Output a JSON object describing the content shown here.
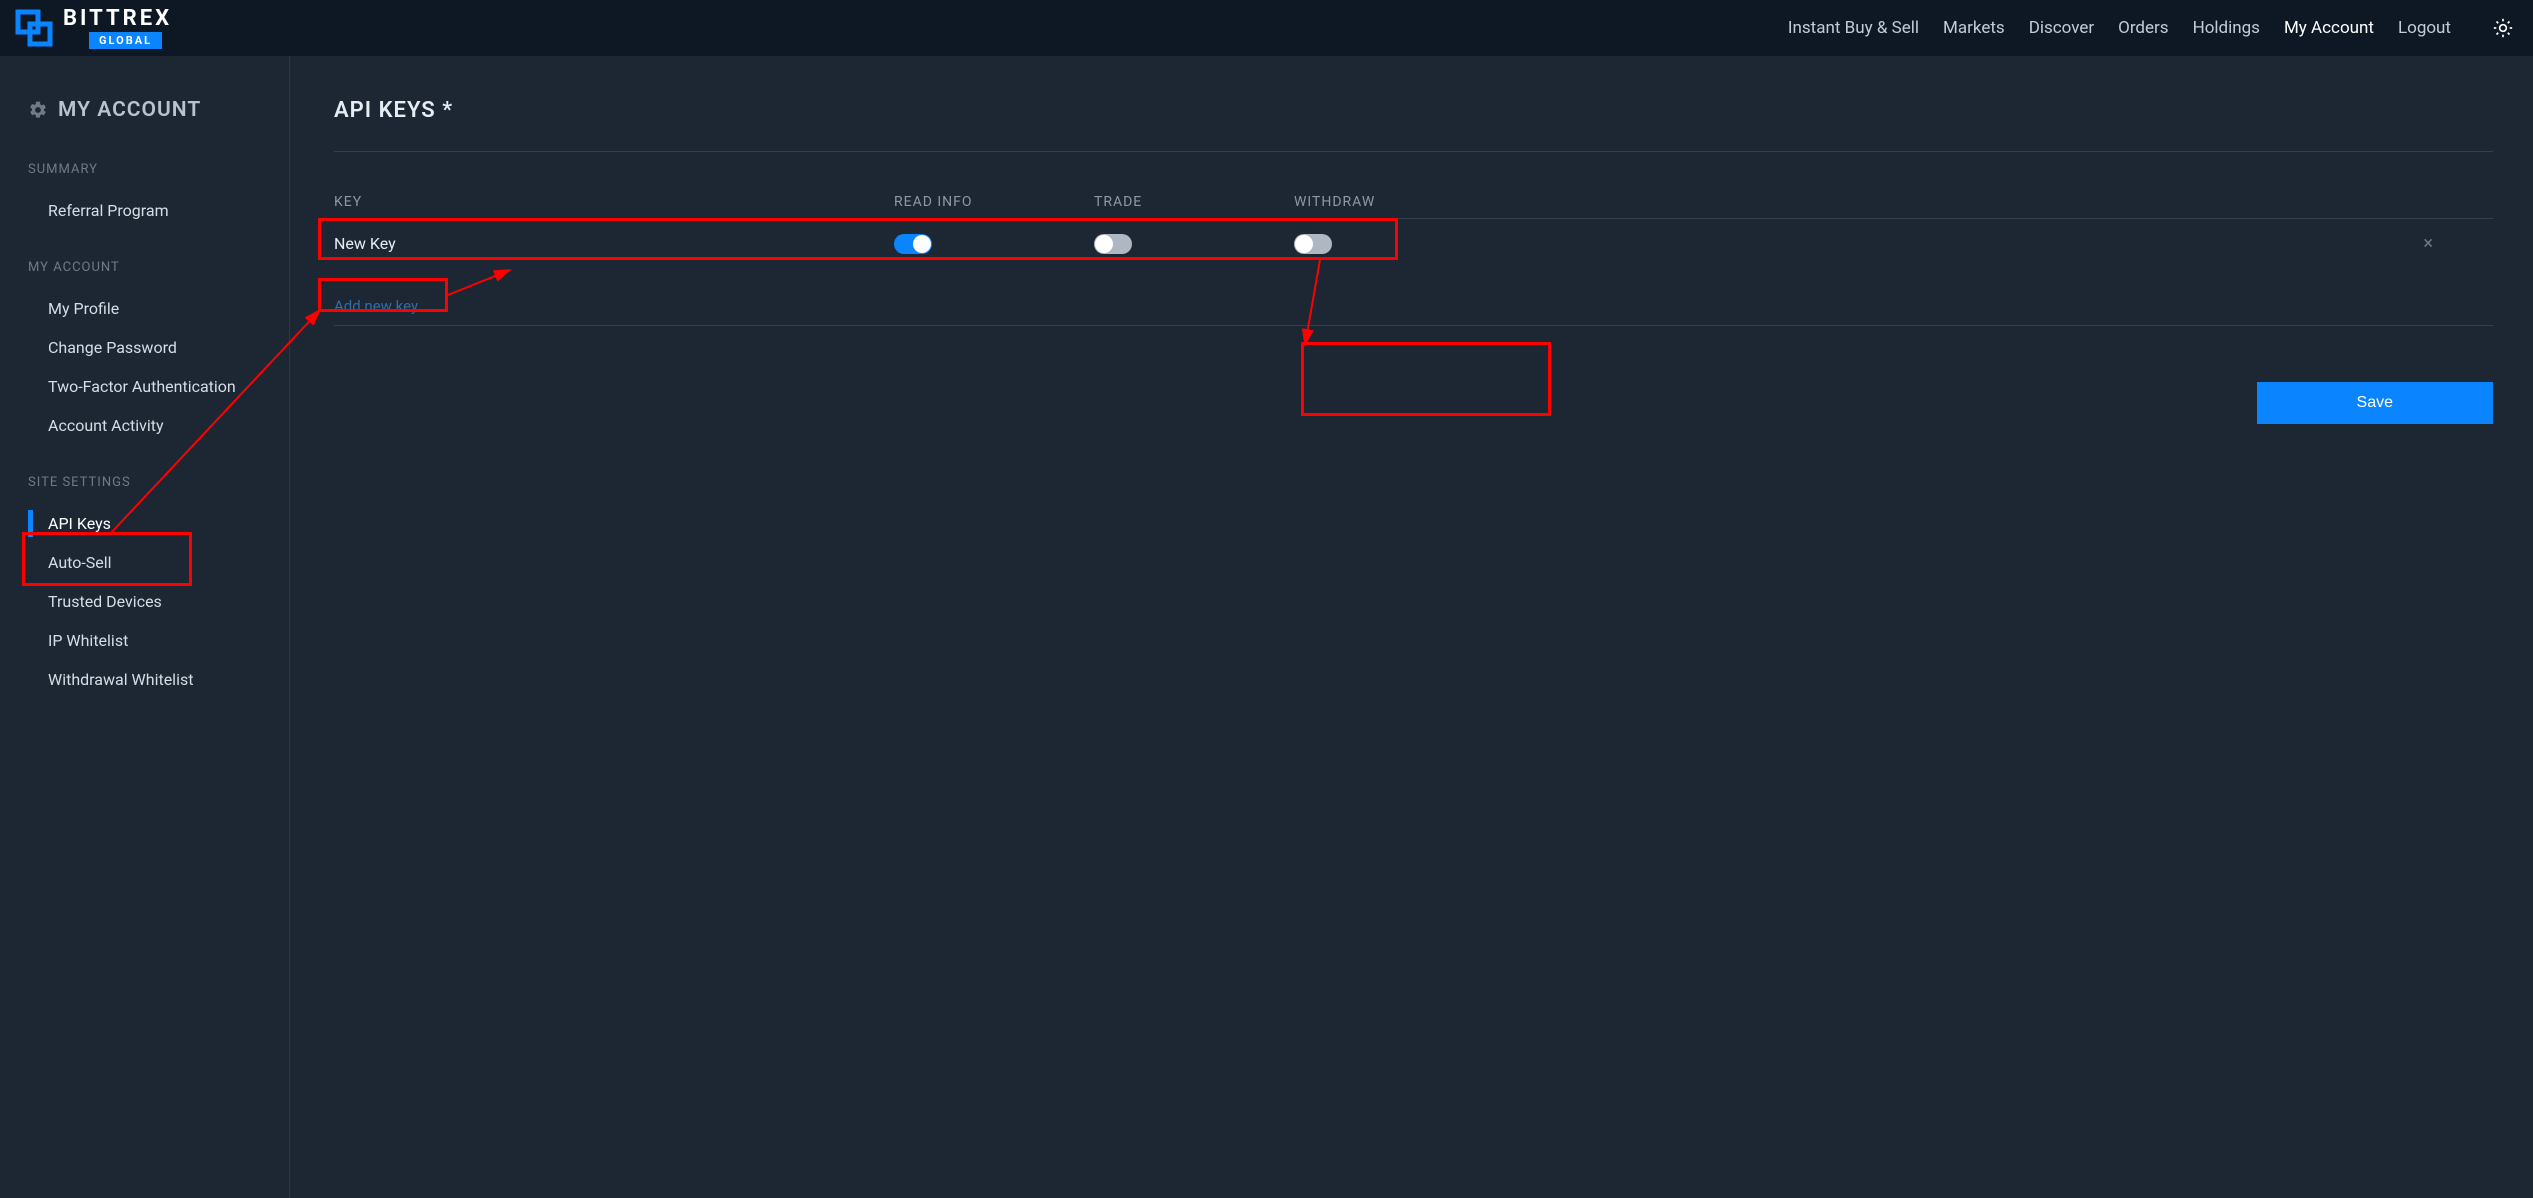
{
  "logo": {
    "brand": "BITTREX",
    "badge": "GLOBAL"
  },
  "nav": {
    "instant": "Instant Buy & Sell",
    "markets": "Markets",
    "discover": "Discover",
    "orders": "Orders",
    "holdings": "Holdings",
    "my_account": "My Account",
    "logout": "Logout"
  },
  "sidebar": {
    "title": "MY ACCOUNT",
    "sections": {
      "summary_label": "SUMMARY",
      "summary": {
        "referral": "Referral Program"
      },
      "my_account_label": "MY ACCOUNT",
      "my_account": {
        "profile": "My Profile",
        "change_pw": "Change Password",
        "two_fa": "Two-Factor Authentication",
        "activity": "Account Activity"
      },
      "site_settings_label": "SITE SETTINGS",
      "site_settings": {
        "api_keys": "API Keys",
        "auto_sell": "Auto-Sell",
        "trusted": "Trusted Devices",
        "ip_whitelist": "IP Whitelist",
        "withdrawal_whitelist": "Withdrawal Whitelist"
      }
    }
  },
  "page": {
    "title": "API KEYS *",
    "columns": {
      "key": "KEY",
      "read_info": "READ INFO",
      "trade": "TRADE",
      "withdraw": "WITHDRAW"
    },
    "row": {
      "name": "New Key",
      "read_info_on": true,
      "trade_on": false,
      "withdraw_on": false
    },
    "add_link": "Add new key...",
    "save": "Save"
  }
}
